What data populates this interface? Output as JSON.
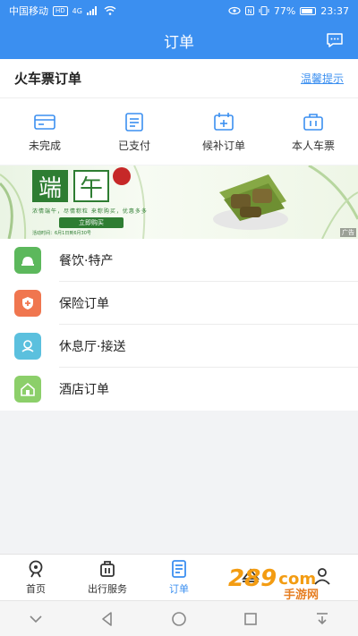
{
  "status_bar": {
    "carrier": "中国移动",
    "hd": "HD",
    "signal": "4G",
    "battery": "77%",
    "time": "23:37"
  },
  "header": {
    "title": "订单",
    "message_icon": "message-icon"
  },
  "section": {
    "title": "火车票订单",
    "tips": "温馨提示"
  },
  "quick_actions": [
    {
      "label": "未完成",
      "icon": "card-icon"
    },
    {
      "label": "已支付",
      "icon": "receipt-icon"
    },
    {
      "label": "候补订单",
      "icon": "calendar-add-icon"
    },
    {
      "label": "本人车票",
      "icon": "ticket-bag-icon"
    }
  ],
  "banner": {
    "char1": "端",
    "char2": "午",
    "subtitle": "浓情端午，尽情粽粒 来粽购买，优惠多多",
    "button": "立即购买",
    "period": "活动时间：6月1日到6月30号",
    "ad": "广告"
  },
  "menu": [
    {
      "label": "餐饮·特产",
      "icon": "food-icon",
      "color": "#5cb85c"
    },
    {
      "label": "保险订单",
      "icon": "shield-icon",
      "color": "#f0764f"
    },
    {
      "label": "休息厅·接送",
      "icon": "lounge-icon",
      "color": "#5bc0de"
    },
    {
      "label": "酒店订单",
      "icon": "hotel-icon",
      "color": "#8ccf6a"
    }
  ],
  "tabbar": [
    {
      "label": "首页",
      "icon": "home-train-icon",
      "active": false
    },
    {
      "label": "出行服务",
      "icon": "luggage-icon",
      "active": false
    },
    {
      "label": "订单",
      "icon": "order-icon",
      "active": true
    },
    {
      "label": "",
      "icon": "hat-icon",
      "active": false
    },
    {
      "label": "",
      "icon": "user-icon",
      "active": false
    }
  ],
  "watermark": {
    "number": "289",
    "suffix": "com",
    "text": "手游网"
  },
  "colors": {
    "primary": "#3b8ff0",
    "tab_active": "#3b8ff0"
  }
}
